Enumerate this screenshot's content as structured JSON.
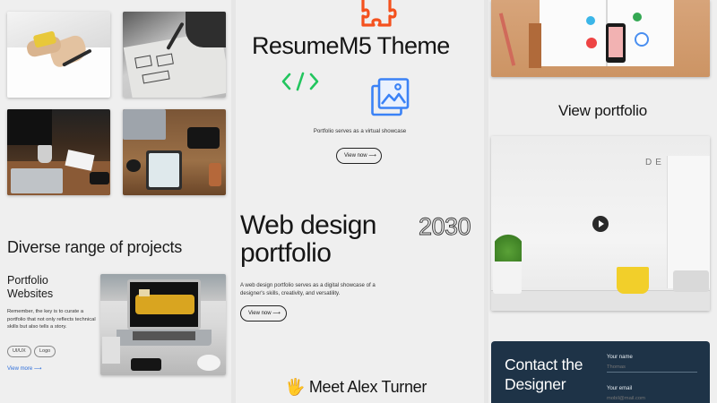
{
  "col_left": {
    "section_title": "Diverse range of projects",
    "card": {
      "title": "Portfolio Websites",
      "body": "Remember, the key is to curate a portfolio that not only reflects technical skills but also tells a story.",
      "tags": [
        "UI/UX",
        "Logo"
      ],
      "link": "View more ⟶"
    }
  },
  "col_middle": {
    "title": "ResumeM5 Theme",
    "subtitle": "Portfolio serves as a virtual showcase",
    "button": "View now ⟶",
    "feature": {
      "title": "Web design portfolio",
      "year": "2030",
      "description": "A web design portfolio serves as a digital showcase of a designer's skills, creativity, and versatility.",
      "button": "View now ⟶"
    },
    "meet": "Meet Alex Turner",
    "meet_emoji": "🖐"
  },
  "col_right": {
    "view_portfolio": "View portfolio",
    "contact": {
      "title": "Contact the Designer",
      "name_label": "Your name",
      "name_placeholder": "Thomas",
      "email_label": "Your email",
      "email_placeholder": "mobil@mail.com"
    }
  },
  "icons": {
    "puzzle": "puzzle-icon",
    "code": "code-icon",
    "gallery": "gallery-icon",
    "play": "play-icon",
    "hand": "waving-hand-icon"
  },
  "colors": {
    "accent_blue": "#3b82f6",
    "code_green": "#22c55e",
    "puzzle_orange": "#f4511e",
    "contact_bg": "#1e3347",
    "link_blue": "#2f6fdb"
  }
}
